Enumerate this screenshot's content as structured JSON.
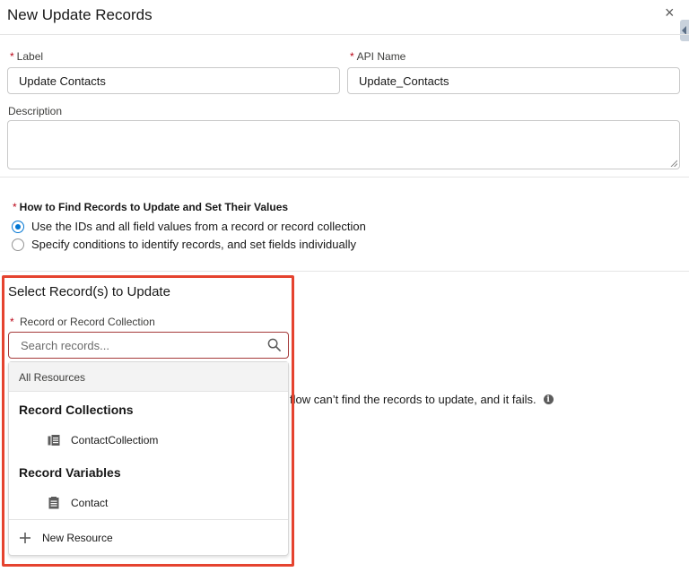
{
  "modal": {
    "title": "New Update Records",
    "close_glyph": "×"
  },
  "fields": {
    "label": {
      "label": "Label",
      "value": "Update Contacts"
    },
    "api_name": {
      "label": "API Name",
      "value": "Update_Contacts"
    },
    "description": {
      "label": "Description",
      "value": ""
    }
  },
  "how_to_find": {
    "label": "How to Find Records to Update and Set Their Values",
    "options": [
      {
        "label": "Use the IDs and all field values from a record or record collection",
        "selected": true
      },
      {
        "label": "Specify conditions to identify records, and set fields individually",
        "selected": false
      }
    ]
  },
  "select_records": {
    "title": "Select Record(s) to Update",
    "field_label": "Record or Record Collection",
    "search_placeholder": "Search records..."
  },
  "dropdown": {
    "all_resources": "All Resources",
    "groups": [
      {
        "label": "Record Collections",
        "items": [
          {
            "label": "ContactCollectiom",
            "icon": "collection-icon"
          }
        ]
      },
      {
        "label": "Record Variables",
        "items": [
          {
            "label": "Contact",
            "icon": "record-icon"
          }
        ]
      }
    ],
    "new_resource": "New Resource"
  },
  "behind_text": "flow can’t find the records to update, and it fails.",
  "required_marker": "*",
  "colors": {
    "accent": "#0176d3",
    "required": "#ba0517",
    "highlight": "#e5432f"
  }
}
